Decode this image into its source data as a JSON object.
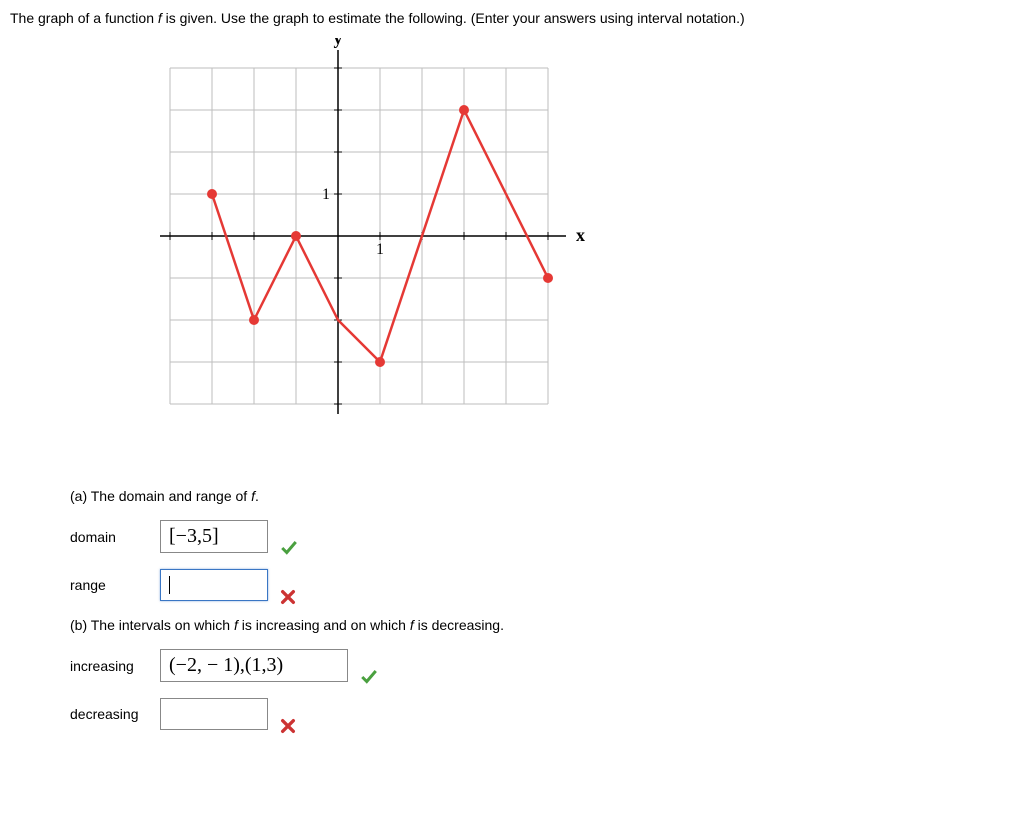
{
  "prompt_before_f": "The graph of a function ",
  "prompt_f": "f",
  "prompt_after_f": " is given. Use the graph to estimate the following. (Enter your answers using interval notation.)",
  "axis_y": "y",
  "axis_x": "x",
  "tick_one_y": "1",
  "tick_one_x": "1",
  "part_a_before": "(a) The domain and range of ",
  "part_a_f": "f",
  "part_a_after": ".",
  "domain_label": "domain",
  "domain_value": "[−3,5]",
  "range_label": "range",
  "range_value": "",
  "part_b_before": "(b) The intervals on which ",
  "part_b_f1": "f",
  "part_b_mid": " is increasing and on which ",
  "part_b_f2": "f",
  "part_b_after": " is decreasing.",
  "increasing_label": "increasing",
  "increasing_value": "(−2, − 1),(1,3)",
  "decreasing_label": "decreasing",
  "decreasing_value": "",
  "mark_correct": "✓",
  "mark_wrong": "✖",
  "chart_data": {
    "type": "line",
    "title": "",
    "xlabel": "x",
    "ylabel": "y",
    "xlim": [
      -4,
      5
    ],
    "ylim": [
      -4,
      4
    ],
    "grid": true,
    "series": [
      {
        "name": "f",
        "color": "#e53935",
        "points": [
          {
            "x": -3,
            "y": 1,
            "marker": true
          },
          {
            "x": -2,
            "y": -2,
            "marker": true
          },
          {
            "x": -1,
            "y": 0,
            "marker": true
          },
          {
            "x": 0,
            "y": -2,
            "marker": false
          },
          {
            "x": 1,
            "y": -3,
            "marker": true
          },
          {
            "x": 3,
            "y": 3,
            "marker": true
          },
          {
            "x": 5,
            "y": -1,
            "marker": true
          }
        ]
      }
    ]
  }
}
